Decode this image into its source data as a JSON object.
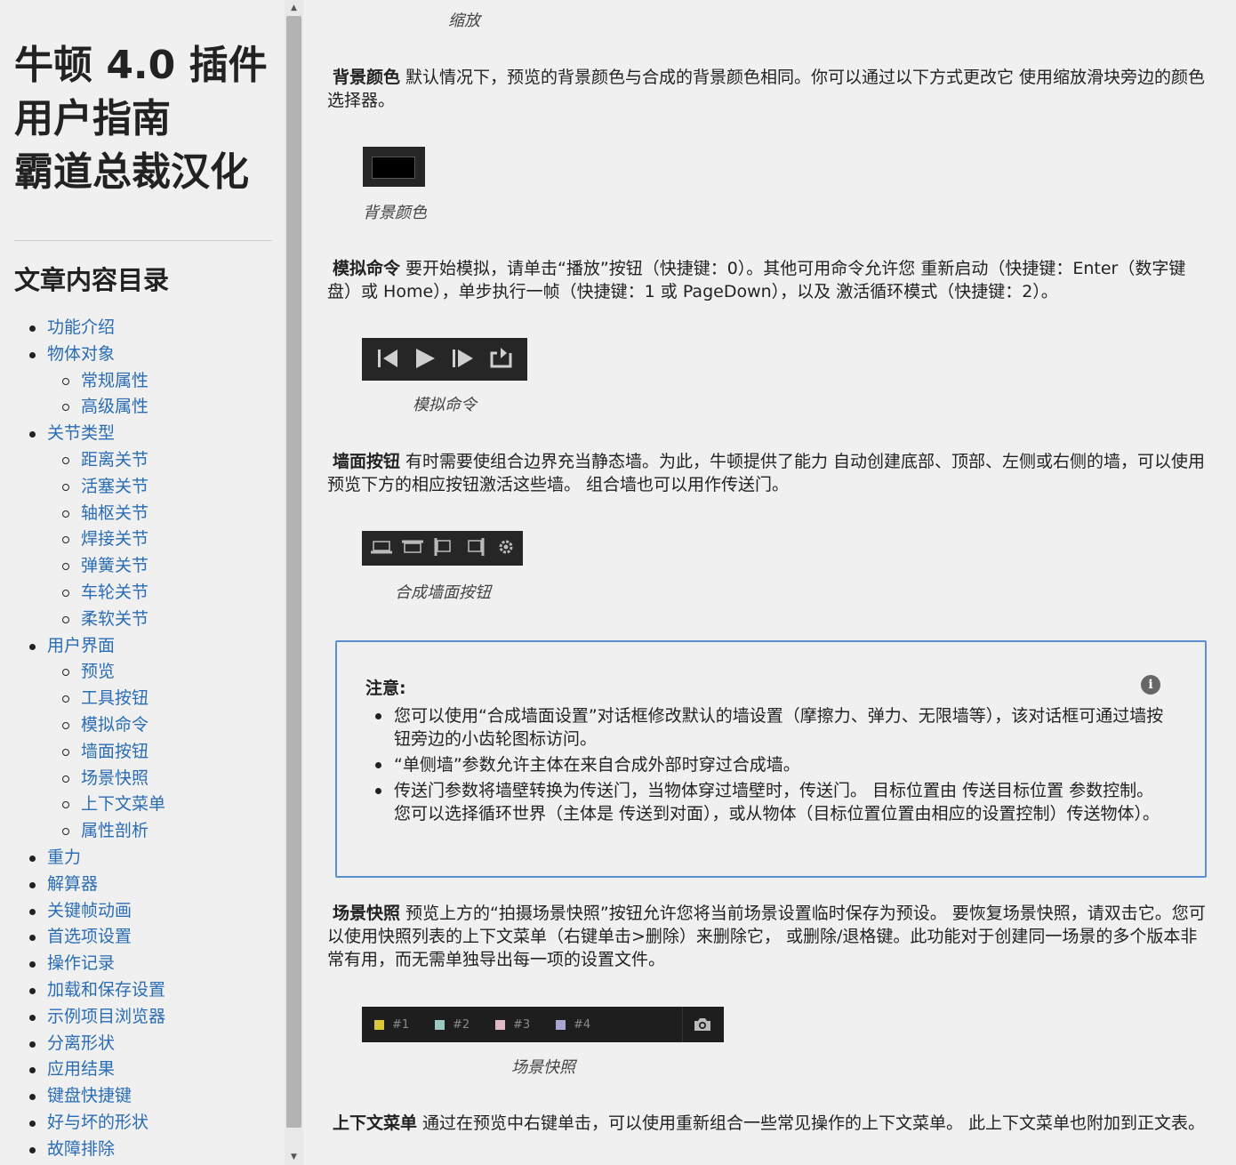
{
  "sidebar": {
    "title_lines": [
      "牛顿 4.0 插件",
      "用户指南",
      "霸道总裁汉化"
    ],
    "toc_heading": "文章内容目录",
    "toc": [
      {
        "label": "功能介绍",
        "level": 1
      },
      {
        "label": "物体对象",
        "level": 1
      },
      {
        "label": "常规属性",
        "level": 2
      },
      {
        "label": "高级属性",
        "level": 2
      },
      {
        "label": "关节类型",
        "level": 1
      },
      {
        "label": "距离关节",
        "level": 2
      },
      {
        "label": "活塞关节",
        "level": 2
      },
      {
        "label": "轴枢关节",
        "level": 2
      },
      {
        "label": "焊接关节",
        "level": 2
      },
      {
        "label": "弹簧关节",
        "level": 2
      },
      {
        "label": "车轮关节",
        "level": 2
      },
      {
        "label": "柔软关节",
        "level": 2
      },
      {
        "label": "用户界面",
        "level": 1
      },
      {
        "label": "预览",
        "level": 2
      },
      {
        "label": "工具按钮",
        "level": 2
      },
      {
        "label": "模拟命令",
        "level": 2
      },
      {
        "label": "墙面按钮",
        "level": 2
      },
      {
        "label": "场景快照",
        "level": 2
      },
      {
        "label": "上下文菜单",
        "level": 2
      },
      {
        "label": "属性剖析",
        "level": 2
      },
      {
        "label": "重力",
        "level": 1
      },
      {
        "label": "解算器",
        "level": 1
      },
      {
        "label": "关键帧动画",
        "level": 1
      },
      {
        "label": "首选项设置",
        "level": 1
      },
      {
        "label": "操作记录",
        "level": 1
      },
      {
        "label": "加载和保存设置",
        "level": 1
      },
      {
        "label": "示例项目浏览器",
        "level": 1
      },
      {
        "label": "分离形状",
        "level": 1
      },
      {
        "label": "应用结果",
        "level": 1
      },
      {
        "label": "键盘快捷键",
        "level": 1
      },
      {
        "label": "好与坏的形状",
        "level": 1
      },
      {
        "label": "故障排除",
        "level": 1
      }
    ]
  },
  "scrollbar": {
    "up_arrow": "▲",
    "down_arrow": "▼"
  },
  "content": {
    "zoom_caption": "缩放",
    "bg_color": {
      "term": "背景颜色",
      "text": "默认情况下，预览的背景颜色与合成的背景颜色相同。你可以通过以下方式更改它 使用缩放滑块旁边的颜色选择器。",
      "caption": "背景颜色",
      "swatch_color": "#000000"
    },
    "sim": {
      "term": "模拟命令",
      "text": "要开始模拟，请单击“播放”按钮（快捷键：0）。其他可用命令允许您 重新启动（快捷键：Enter（数字键盘）或 Home），单步执行一帧（快捷键：1 或 PageDown），以及 激活循环模式（快捷键：2）。",
      "caption": "模拟命令"
    },
    "wall": {
      "term": "墙面按钮",
      "text": "有时需要使组合边界充当静态墙。为此，牛顿提供了能力 自动创建底部、顶部、左侧或右侧的墙，可以使用预览下方的相应按钮激活这些墙。 组合墙也可以用作传送门。",
      "caption": "合成墙面按钮"
    },
    "note": {
      "title": "注意:",
      "items": [
        "您可以使用“合成墙面设置”对话框修改默认的墙设置（摩擦力、弹力、无限墙等），该对话框可通过墙按钮旁边的小齿轮图标访问。",
        "“单侧墙”参数允许主体在来自合成外部时穿过合成墙。",
        "传送门参数将墙壁转换为传送门，当物体穿过墙壁时，传送门。 目标位置由 传送目标位置 参数控制。您可以选择循环世界（主体是 传送到对面），或从物体（目标位置位置由相应的设置控制）传送物体）。"
      ]
    },
    "snapshot": {
      "term": "场景快照",
      "text": "预览上方的“拍摄场景快照”按钮允许您将当前场景设置临时保存为预设。 要恢复场景快照，请双击它。您可以使用快照列表的上下文菜单（右键单击>删除）来删除它， 或删除/退格键。此功能对于创建同一场景的多个版本非常有用，而无需单独导出每一项的设置文件。",
      "caption": "场景快照",
      "slots": [
        {
          "label": "#1",
          "color": "#d9c93a"
        },
        {
          "label": "#2",
          "color": "#9cc7c2"
        },
        {
          "label": "#3",
          "color": "#e0b7c4"
        },
        {
          "label": "#4",
          "color": "#a9a6d4"
        }
      ]
    },
    "context_menu": {
      "term": "上下文菜单",
      "text": "通过在预览中右键单击，可以使用重新组合一些常见操作的上下文菜单。 此上下文菜单也附加到正文表。"
    }
  }
}
